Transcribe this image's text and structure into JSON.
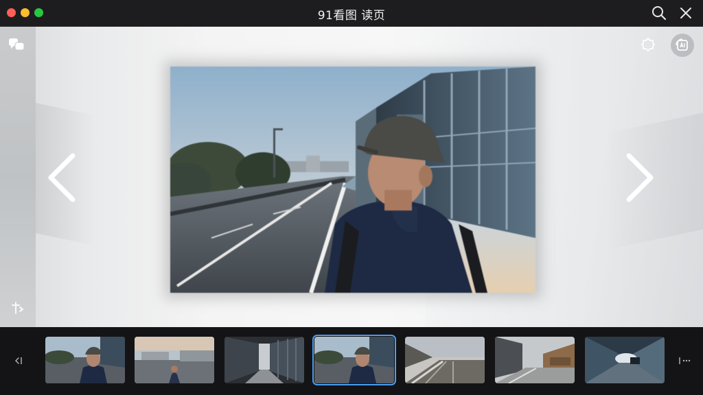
{
  "window": {
    "title": "91看图 读页",
    "controls": [
      "close",
      "minimize",
      "maximize"
    ]
  },
  "toolbar": {
    "icons": [
      "search-icon",
      "close-icon"
    ]
  },
  "viewer": {
    "left_tools": [
      "chat-icon",
      "rotate-icon"
    ],
    "right_tools": [
      "tag-icon",
      "ai-enhance-icon"
    ],
    "nav": [
      "chevron-left-icon",
      "chevron-right-icon"
    ]
  },
  "filmstrip": {
    "thumbnails": 7,
    "selected_index": 3,
    "accent_color": "#4a9ef5"
  }
}
